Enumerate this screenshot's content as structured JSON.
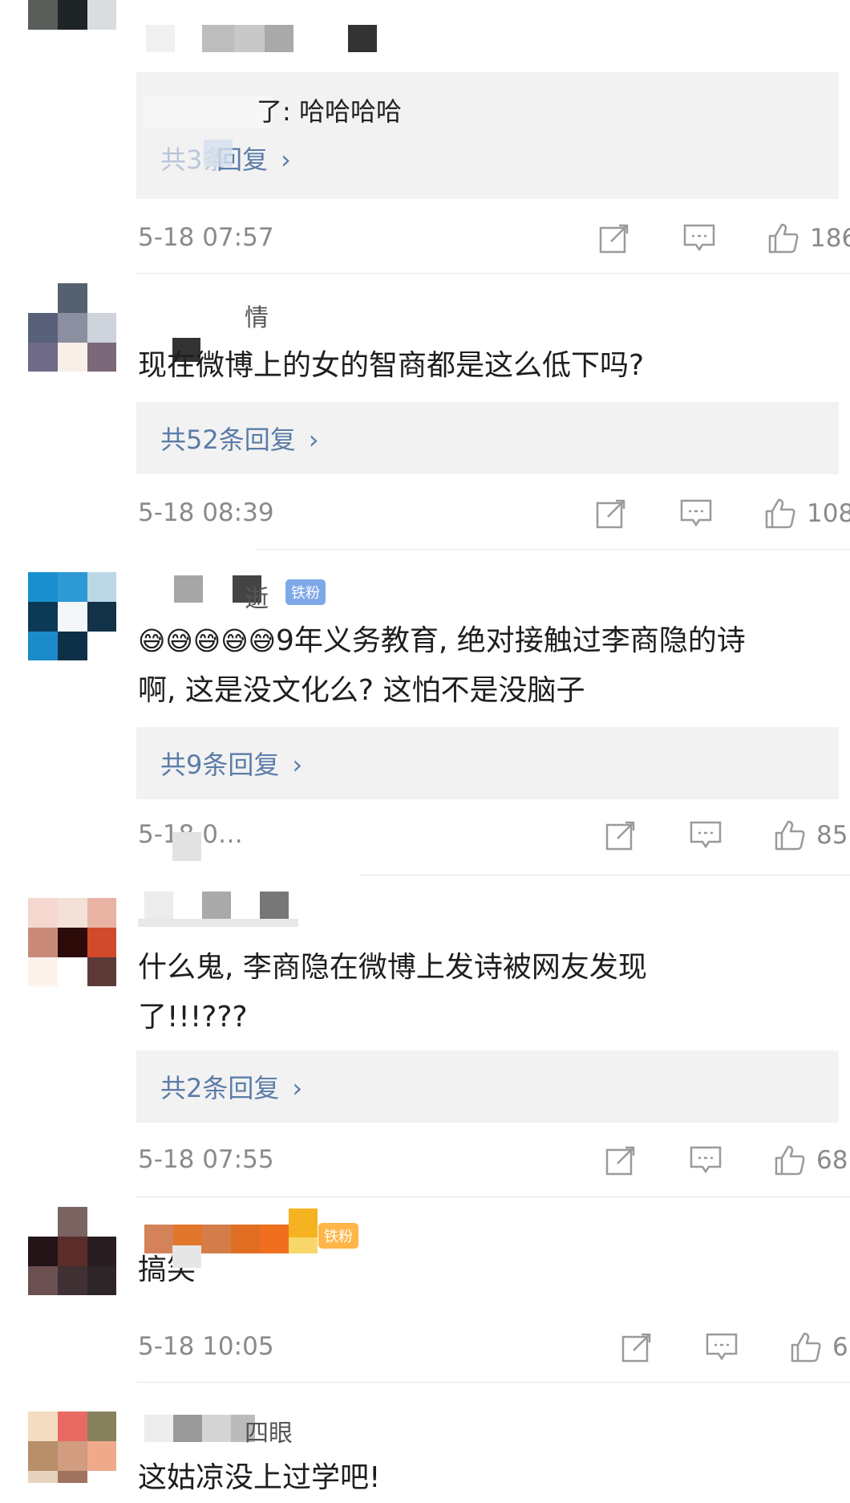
{
  "comments": [
    {
      "id": "c1",
      "reply_preview_text": "了: 哈哈哈哈",
      "reply_link_label": "回复",
      "timestamp": "5-18 07:57",
      "likes": "186"
    },
    {
      "id": "c2",
      "username_tail": "情",
      "text": "现在微博上的女的智商都是这么低下吗?",
      "reply_link_label": "共52条回复",
      "timestamp": "5-18 08:39",
      "likes": "108"
    },
    {
      "id": "c3",
      "username_tail": "逝",
      "badge": "铁粉",
      "text_emoji": "😅😅😅😅😅",
      "text_line1": "9年义务教育, 绝对接触过李商隐的诗",
      "text_line2": "啊, 这是没文化么? 这怕不是没脑子",
      "reply_link_label": "共9条回复",
      "timestamp": "5-18 0…",
      "likes": "85"
    },
    {
      "id": "c4",
      "text_line1": "什么鬼, 李商隐在微博上发诗被网友发现",
      "text_line2": "了!!!???",
      "reply_link_label": "共2条回复",
      "timestamp": "5-18 07:55",
      "likes": "68"
    },
    {
      "id": "c5",
      "badge": "铁粉",
      "text": "搞笑",
      "timestamp": "5-18 10:05",
      "likes": "6"
    },
    {
      "id": "c6",
      "username_tail": "四眼",
      "text": "这姑凉没上过学吧!"
    }
  ],
  "icons": {
    "share": "share-icon",
    "comment": "comment-icon",
    "like": "like-icon",
    "chevron": "chevron-right-icon"
  },
  "colors": {
    "link": "#5b7ca8",
    "meta": "#8a8a8a",
    "reply_bg": "#f2f2f2",
    "badge_blue": "#7fa8e8",
    "badge_orange": "#ffb547"
  }
}
